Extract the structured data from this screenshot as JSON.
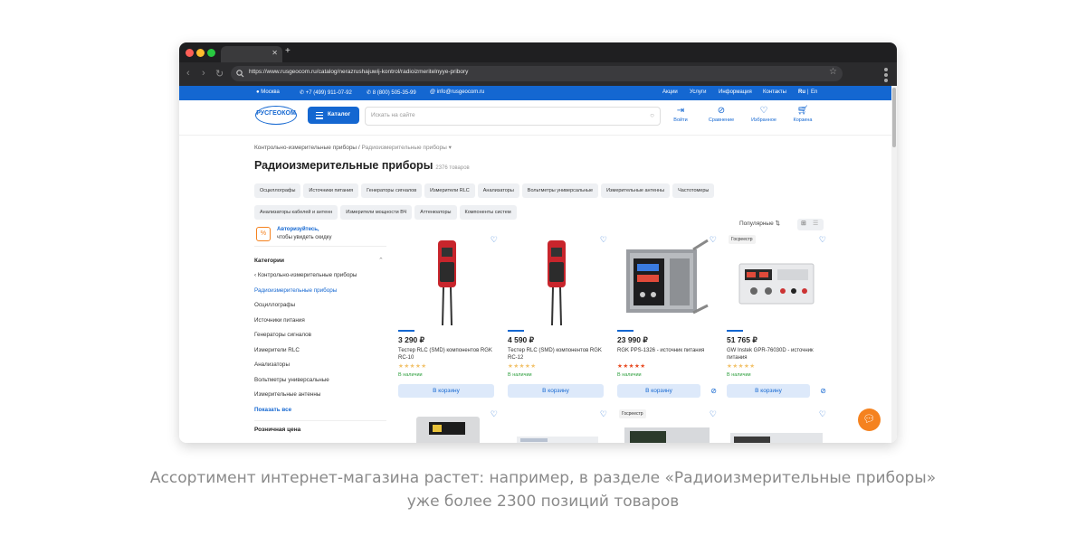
{
  "browser": {
    "url": "https://www.rusgeocom.ru/catalog/nerazrushajuwij-kontrol/radioizmeritelnyye-pribory",
    "traffic_colors": [
      "#ff5f57",
      "#febc2e",
      "#28c840"
    ]
  },
  "topbar": {
    "city": "Москва",
    "phone1": "+7 (499) 911-07-92",
    "phone2": "8 (800) 505-35-99",
    "email": "info@rusgeocom.ru",
    "links": [
      "Акции",
      "Услуги",
      "Информация",
      "Контакты"
    ],
    "lang_ru": "Ru",
    "lang_sep": "|",
    "lang_en": "En"
  },
  "header": {
    "logo": "РУСГЕОКОМ",
    "catalog_label": "Каталог",
    "search_placeholder": "Искать на сайте",
    "actions": [
      {
        "label": "Войти",
        "icon": "login-icon"
      },
      {
        "label": "Сравнение",
        "icon": "compare-icon"
      },
      {
        "label": "Избранное",
        "icon": "heart-icon"
      },
      {
        "label": "Корзина",
        "icon": "cart-icon"
      }
    ]
  },
  "breadcrumb": {
    "parent": "Контрольно-измерительные приборы",
    "sep": "/",
    "current": "Радиоизмерительные приборы"
  },
  "page": {
    "title": "Радиоизмерительные приборы",
    "count": "2376 товаров"
  },
  "chips": [
    "Осциллографы",
    "Источники питания",
    "Генераторы сигналов",
    "Измерители RLC",
    "Анализаторы",
    "Вольтметры универсальные",
    "Измерительные антенны",
    "Частотомеры",
    "Анализаторы кабелей и антенн",
    "Измерители мощности ВЧ",
    "Аттенюаторы",
    "Компоненты систем"
  ],
  "auth": {
    "title": "Авторизуйтесь,",
    "subtitle": "чтобы увидеть скидку"
  },
  "sidebar": {
    "heading": "Категории",
    "back": "Контрольно-измерительные приборы",
    "items": [
      "Радиоизмерительные приборы",
      "Осциллографы",
      "Источники питания",
      "Генераторы сигналов",
      "Измерители RLC",
      "Анализаторы",
      "Вольтметры универсальные",
      "Измерительные антенны"
    ],
    "show_all": "Показать все",
    "price_heading": "Розничная цена"
  },
  "sort": {
    "label": "Популярные"
  },
  "products": [
    {
      "price": "3 290 ₽",
      "name": "Тестер RLC (SMD) компонентов RGK RC-10",
      "stars": "★★★★★",
      "stock": "В наличии",
      "cart": "В корзину",
      "badge": ""
    },
    {
      "price": "4 590 ₽",
      "name": "Тестер RLC (SMD) компонентов RGK RC-12",
      "stars": "★★★★★",
      "stock": "В наличии",
      "cart": "В корзину",
      "badge": ""
    },
    {
      "price": "23 990 ₽",
      "name": "RGK PPS-1326 - источник питания",
      "stars": "★★★★★",
      "stock": "В наличии",
      "cart": "В корзину",
      "badge": ""
    },
    {
      "price": "51 765 ₽",
      "name": "GW Instek GPR-76030D - источник питания",
      "stars": "★★★★★",
      "stock": "В наличии",
      "cart": "В корзину",
      "badge": "Госреестр"
    }
  ],
  "products_row2_badge": "Госреестр",
  "caption": {
    "line1": "Ассортимент интернет-магазина растет: например, в разделе «Радиоизмерительные приборы»",
    "line2": "уже более 2300 позиций товаров"
  },
  "colors": {
    "brand_blue": "#1467d1",
    "accent_orange": "#f5821f",
    "in_stock_green": "#2a9d3a"
  }
}
